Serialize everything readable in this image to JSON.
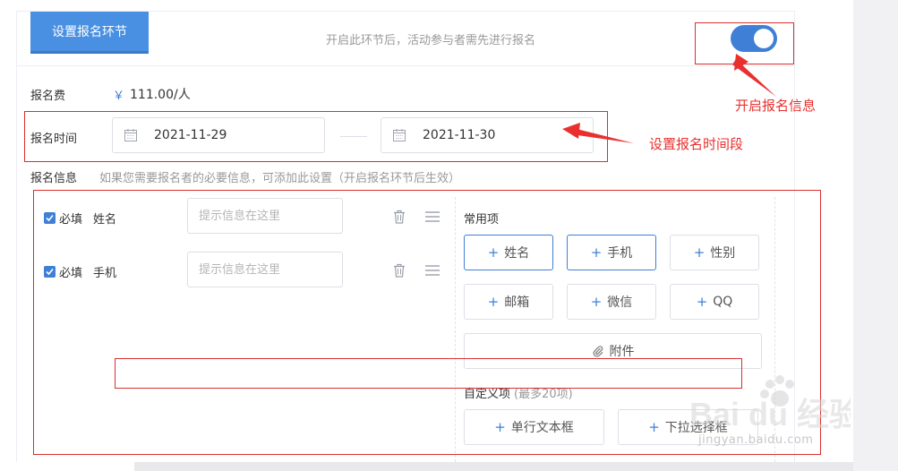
{
  "header": {
    "section_tag": "设置报名环节",
    "hint": "开启此环节后，活动参与者需先进行报名",
    "toggle_on": true
  },
  "fee": {
    "label": "报名费",
    "symbol": "￥",
    "value": "111.00/人"
  },
  "time": {
    "label": "报名时间",
    "start": "2021-11-29",
    "end": "2021-11-30"
  },
  "info": {
    "label": "报名信息",
    "hint": "如果您需要报名者的必要信息，可添加此设置（开启报名环节后生效）"
  },
  "fields": [
    {
      "required_label": "必填",
      "name": "姓名",
      "placeholder": "提示信息在这里"
    },
    {
      "required_label": "必填",
      "name": "手机",
      "placeholder": "提示信息在这里"
    }
  ],
  "common": {
    "title": "常用项",
    "options": [
      "姓名",
      "手机",
      "性别",
      "邮箱",
      "微信",
      "QQ"
    ],
    "attachment": "附件"
  },
  "custom": {
    "title": "自定义项",
    "hint": "(最多20项)",
    "options": [
      "单行文本框",
      "下拉选择框"
    ]
  },
  "annotations": {
    "enable_info": "开启报名信息",
    "set_time": "设置报名时间段"
  },
  "watermark": {
    "brand": "Bai du 经验",
    "site": "jingyan.baidu.com"
  },
  "colors": {
    "accent": "#3f7fd6",
    "annotation": "#e8312f"
  }
}
